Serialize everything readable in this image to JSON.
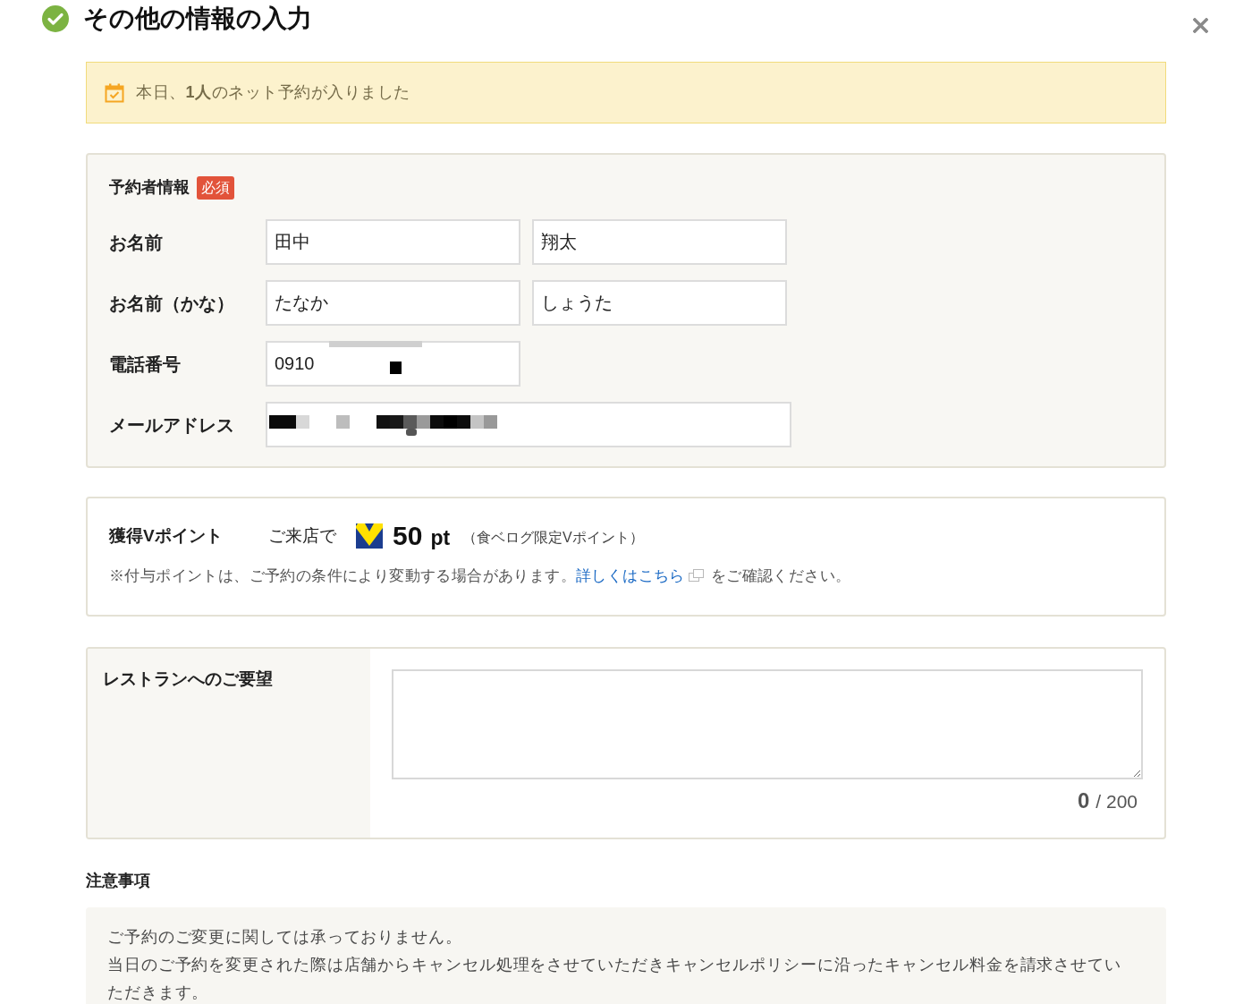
{
  "header": {
    "title": "その他の情報の入力"
  },
  "notice": {
    "text": "本日、**1人**のネット予約が入りました"
  },
  "reserver": {
    "heading": "予約者情報",
    "badge": "必須",
    "rows": [
      {
        "kind": "pair",
        "label": "お名前",
        "inputs": [
          {
            "value": "田中",
            "redacted": false
          },
          {
            "value": "翔太",
            "redacted": false
          }
        ]
      },
      {
        "kind": "pair",
        "label": "お名前（かな）",
        "inputs": [
          {
            "value": "たなか",
            "redacted": false
          },
          {
            "value": "しょうた",
            "redacted": false
          }
        ]
      },
      {
        "kind": "single",
        "label": "電話番号",
        "inputs": [
          {
            "value": "0910",
            "redacted": true
          }
        ]
      },
      {
        "kind": "wide",
        "label": "メールアドレス",
        "inputs": [
          {
            "redacted": true
          }
        ]
      }
    ]
  },
  "points": {
    "label": "獲得Vポイント",
    "prefix": "ご来店で",
    "amount": "50",
    "unit": "pt",
    "note": "（食ベログ限定Vポイント）",
    "disclaimer": {
      "before": "※付与ポイントは、ご予約の条件により変動する場合があります。",
      "link": "詳しくはこちら",
      "after": "をご確認ください。"
    }
  },
  "request": {
    "label": "レストランへのご要望",
    "count": "0",
    "limit": "/ 200"
  },
  "notes": {
    "heading": "注意事項",
    "lines": [
      "ご予約のご変更に関しては承っておりません。",
      "当日のご予約を変更された際は店舗からキャンセル処理をさせていただきキャンセルポリシーに沿ったキャンセル料金を請求させていただきます。"
    ]
  }
}
